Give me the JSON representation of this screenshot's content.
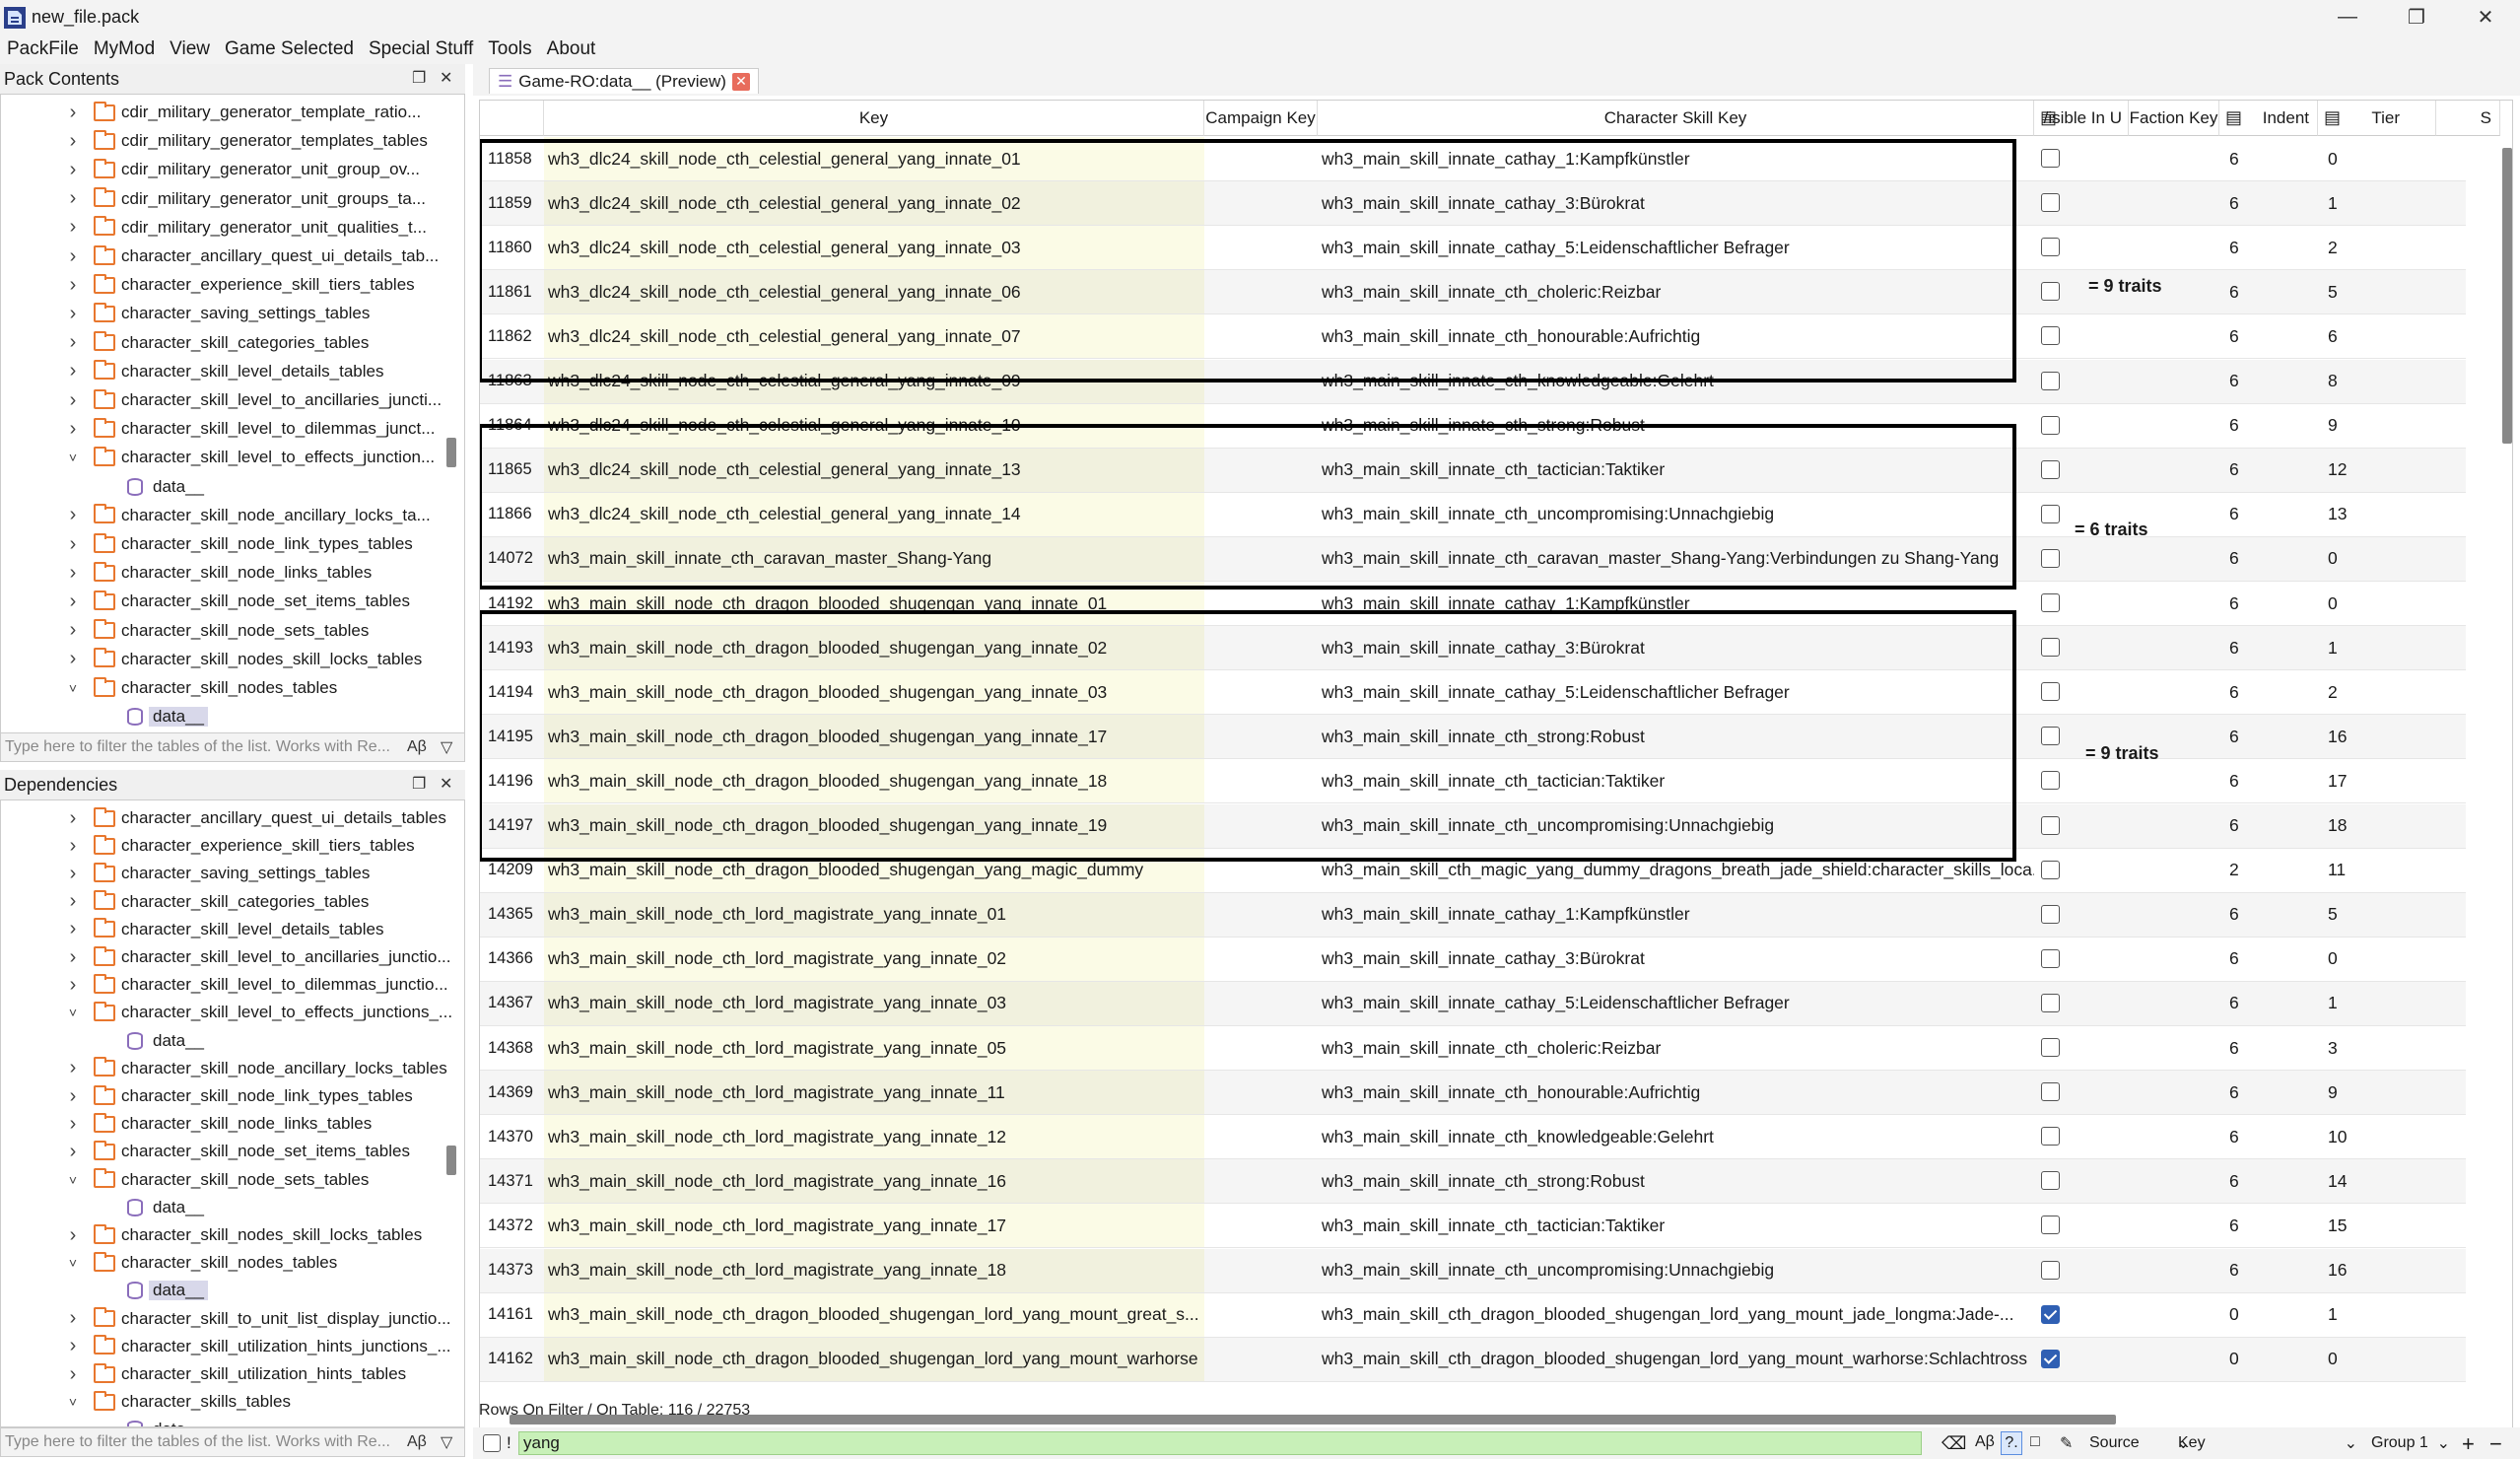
{
  "window": {
    "title": "new_file.pack"
  },
  "menu": [
    "PackFile",
    "MyMod",
    "View",
    "Game Selected",
    "Special Stuff",
    "Tools",
    "About"
  ],
  "pack_contents": {
    "title": "Pack Contents",
    "items": [
      {
        "label": "cdir_military_generator_template_ratio...",
        "type": "folder",
        "state": "collapsed"
      },
      {
        "label": "cdir_military_generator_templates_tables",
        "type": "folder",
        "state": "collapsed"
      },
      {
        "label": "cdir_military_generator_unit_group_ov...",
        "type": "folder",
        "state": "collapsed"
      },
      {
        "label": "cdir_military_generator_unit_groups_ta...",
        "type": "folder",
        "state": "collapsed"
      },
      {
        "label": "cdir_military_generator_unit_qualities_t...",
        "type": "folder",
        "state": "collapsed"
      },
      {
        "label": "character_ancillary_quest_ui_details_tab...",
        "type": "folder",
        "state": "collapsed"
      },
      {
        "label": "character_experience_skill_tiers_tables",
        "type": "folder",
        "state": "collapsed"
      },
      {
        "label": "character_saving_settings_tables",
        "type": "folder",
        "state": "collapsed"
      },
      {
        "label": "character_skill_categories_tables",
        "type": "folder",
        "state": "collapsed"
      },
      {
        "label": "character_skill_level_details_tables",
        "type": "folder",
        "state": "collapsed"
      },
      {
        "label": "character_skill_level_to_ancillaries_juncti...",
        "type": "folder",
        "state": "collapsed"
      },
      {
        "label": "character_skill_level_to_dilemmas_junct...",
        "type": "folder",
        "state": "collapsed"
      },
      {
        "label": "character_skill_level_to_effects_junction...",
        "type": "folder",
        "state": "expanded"
      },
      {
        "label": "data__",
        "type": "leaf"
      },
      {
        "label": "character_skill_node_ancillary_locks_ta...",
        "type": "folder",
        "state": "collapsed"
      },
      {
        "label": "character_skill_node_link_types_tables",
        "type": "folder",
        "state": "collapsed"
      },
      {
        "label": "character_skill_node_links_tables",
        "type": "folder",
        "state": "collapsed"
      },
      {
        "label": "character_skill_node_set_items_tables",
        "type": "folder",
        "state": "collapsed"
      },
      {
        "label": "character_skill_node_sets_tables",
        "type": "folder",
        "state": "collapsed"
      },
      {
        "label": "character_skill_nodes_skill_locks_tables",
        "type": "folder",
        "state": "collapsed"
      },
      {
        "label": "character_skill_nodes_tables",
        "type": "folder",
        "state": "expanded"
      },
      {
        "label": "data__",
        "type": "leaf",
        "selected": true
      }
    ],
    "filter_placeholder": "Type here to filter the tables of the list. Works with Re..."
  },
  "dependencies": {
    "title": "Dependencies",
    "items": [
      {
        "label": "character_ancillary_quest_ui_details_tables",
        "type": "folder",
        "state": "collapsed"
      },
      {
        "label": "character_experience_skill_tiers_tables",
        "type": "folder",
        "state": "collapsed"
      },
      {
        "label": "character_saving_settings_tables",
        "type": "folder",
        "state": "collapsed"
      },
      {
        "label": "character_skill_categories_tables",
        "type": "folder",
        "state": "collapsed"
      },
      {
        "label": "character_skill_level_details_tables",
        "type": "folder",
        "state": "collapsed"
      },
      {
        "label": "character_skill_level_to_ancillaries_junctio...",
        "type": "folder",
        "state": "collapsed"
      },
      {
        "label": "character_skill_level_to_dilemmas_junctio...",
        "type": "folder",
        "state": "collapsed"
      },
      {
        "label": "character_skill_level_to_effects_junctions_...",
        "type": "folder",
        "state": "expanded"
      },
      {
        "label": "data__",
        "type": "leaf"
      },
      {
        "label": "character_skill_node_ancillary_locks_tables",
        "type": "folder",
        "state": "collapsed"
      },
      {
        "label": "character_skill_node_link_types_tables",
        "type": "folder",
        "state": "collapsed"
      },
      {
        "label": "character_skill_node_links_tables",
        "type": "folder",
        "state": "collapsed"
      },
      {
        "label": "character_skill_node_set_items_tables",
        "type": "folder",
        "state": "collapsed"
      },
      {
        "label": "character_skill_node_sets_tables",
        "type": "folder",
        "state": "expanded"
      },
      {
        "label": "data__",
        "type": "leaf"
      },
      {
        "label": "character_skill_nodes_skill_locks_tables",
        "type": "folder",
        "state": "collapsed"
      },
      {
        "label": "character_skill_nodes_tables",
        "type": "folder",
        "state": "expanded"
      },
      {
        "label": "data__",
        "type": "leaf",
        "selected": true
      },
      {
        "label": "character_skill_to_unit_list_display_junctio...",
        "type": "folder",
        "state": "collapsed"
      },
      {
        "label": "character_skill_utilization_hints_junctions_...",
        "type": "folder",
        "state": "collapsed"
      },
      {
        "label": "character_skill_utilization_hints_tables",
        "type": "folder",
        "state": "collapsed"
      },
      {
        "label": "character_skills_tables",
        "type": "folder",
        "state": "expanded"
      },
      {
        "label": "data__",
        "type": "leaf"
      }
    ],
    "filter_placeholder": "Type here to filter the tables of the list. Works with Re..."
  },
  "tab": {
    "label": "Game-RO:data__ (Preview)"
  },
  "table": {
    "columns": [
      "Key",
      "Campaign Key",
      "Character Skill Key",
      "/isible In U",
      "Faction Key",
      "Indent",
      "Tier",
      "S"
    ],
    "rows": [
      [
        "11858",
        "wh3_dlc24_skill_node_cth_celestial_general_yang_innate_01",
        "wh3_main_skill_innate_cathay_1:Kampfkünstler",
        false,
        "6",
        "0"
      ],
      [
        "11859",
        "wh3_dlc24_skill_node_cth_celestial_general_yang_innate_02",
        "wh3_main_skill_innate_cathay_3:Bürokrat",
        false,
        "6",
        "1"
      ],
      [
        "11860",
        "wh3_dlc24_skill_node_cth_celestial_general_yang_innate_03",
        "wh3_main_skill_innate_cathay_5:Leidenschaftlicher Befrager",
        false,
        "6",
        "2"
      ],
      [
        "11861",
        "wh3_dlc24_skill_node_cth_celestial_general_yang_innate_06",
        "wh3_main_skill_innate_cth_choleric:Reizbar",
        false,
        "6",
        "5"
      ],
      [
        "11862",
        "wh3_dlc24_skill_node_cth_celestial_general_yang_innate_07",
        "wh3_main_skill_innate_cth_honourable:Aufrichtig",
        false,
        "6",
        "6"
      ],
      [
        "11863",
        "wh3_dlc24_skill_node_cth_celestial_general_yang_innate_09",
        "wh3_main_skill_innate_cth_knowledgeable:Gelehrt",
        false,
        "6",
        "8"
      ],
      [
        "11864",
        "wh3_dlc24_skill_node_cth_celestial_general_yang_innate_10",
        "wh3_main_skill_innate_cth_strong:Robust",
        false,
        "6",
        "9"
      ],
      [
        "11865",
        "wh3_dlc24_skill_node_cth_celestial_general_yang_innate_13",
        "wh3_main_skill_innate_cth_tactician:Taktiker",
        false,
        "6",
        "12"
      ],
      [
        "11866",
        "wh3_dlc24_skill_node_cth_celestial_general_yang_innate_14",
        "wh3_main_skill_innate_cth_uncompromising:Unnachgiebig",
        false,
        "6",
        "13"
      ],
      [
        "14072",
        "wh3_main_skill_innate_cth_caravan_master_Shang-Yang",
        "wh3_main_skill_innate_cth_caravan_master_Shang-Yang:Verbindungen zu Shang-Yang",
        false,
        "6",
        "0"
      ],
      [
        "14192",
        "wh3_main_skill_node_cth_dragon_blooded_shugengan_yang_innate_01",
        "wh3_main_skill_innate_cathay_1:Kampfkünstler",
        false,
        "6",
        "0"
      ],
      [
        "14193",
        "wh3_main_skill_node_cth_dragon_blooded_shugengan_yang_innate_02",
        "wh3_main_skill_innate_cathay_3:Bürokrat",
        false,
        "6",
        "1"
      ],
      [
        "14194",
        "wh3_main_skill_node_cth_dragon_blooded_shugengan_yang_innate_03",
        "wh3_main_skill_innate_cathay_5:Leidenschaftlicher Befrager",
        false,
        "6",
        "2"
      ],
      [
        "14195",
        "wh3_main_skill_node_cth_dragon_blooded_shugengan_yang_innate_17",
        "wh3_main_skill_innate_cth_strong:Robust",
        false,
        "6",
        "16"
      ],
      [
        "14196",
        "wh3_main_skill_node_cth_dragon_blooded_shugengan_yang_innate_18",
        "wh3_main_skill_innate_cth_tactician:Taktiker",
        false,
        "6",
        "17"
      ],
      [
        "14197",
        "wh3_main_skill_node_cth_dragon_blooded_shugengan_yang_innate_19",
        "wh3_main_skill_innate_cth_uncompromising:Unnachgiebig",
        false,
        "6",
        "18"
      ],
      [
        "14209",
        "wh3_main_skill_node_cth_dragon_blooded_shugengan_yang_magic_dummy",
        "wh3_main_skill_cth_magic_yang_dummy_dragons_breath_jade_shield:character_skills_loca...",
        false,
        "2",
        "11"
      ],
      [
        "14365",
        "wh3_main_skill_node_cth_lord_magistrate_yang_innate_01",
        "wh3_main_skill_innate_cathay_1:Kampfkünstler",
        false,
        "6",
        "5"
      ],
      [
        "14366",
        "wh3_main_skill_node_cth_lord_magistrate_yang_innate_02",
        "wh3_main_skill_innate_cathay_3:Bürokrat",
        false,
        "6",
        "0"
      ],
      [
        "14367",
        "wh3_main_skill_node_cth_lord_magistrate_yang_innate_03",
        "wh3_main_skill_innate_cathay_5:Leidenschaftlicher Befrager",
        false,
        "6",
        "1"
      ],
      [
        "14368",
        "wh3_main_skill_node_cth_lord_magistrate_yang_innate_05",
        "wh3_main_skill_innate_cth_choleric:Reizbar",
        false,
        "6",
        "3"
      ],
      [
        "14369",
        "wh3_main_skill_node_cth_lord_magistrate_yang_innate_11",
        "wh3_main_skill_innate_cth_honourable:Aufrichtig",
        false,
        "6",
        "9"
      ],
      [
        "14370",
        "wh3_main_skill_node_cth_lord_magistrate_yang_innate_12",
        "wh3_main_skill_innate_cth_knowledgeable:Gelehrt",
        false,
        "6",
        "10"
      ],
      [
        "14371",
        "wh3_main_skill_node_cth_lord_magistrate_yang_innate_16",
        "wh3_main_skill_innate_cth_strong:Robust",
        false,
        "6",
        "14"
      ],
      [
        "14372",
        "wh3_main_skill_node_cth_lord_magistrate_yang_innate_17",
        "wh3_main_skill_innate_cth_tactician:Taktiker",
        false,
        "6",
        "15"
      ],
      [
        "14373",
        "wh3_main_skill_node_cth_lord_magistrate_yang_innate_18",
        "wh3_main_skill_innate_cth_uncompromising:Unnachgiebig",
        false,
        "6",
        "16"
      ],
      [
        "14161",
        "wh3_main_skill_node_cth_dragon_blooded_shugengan_lord_yang_mount_great_s...",
        "wh3_main_skill_cth_dragon_blooded_shugengan_lord_yang_mount_jade_longma:Jade-...",
        true,
        "0",
        "1"
      ],
      [
        "14162",
        "wh3_main_skill_node_cth_dragon_blooded_shugengan_lord_yang_mount_warhorse",
        "wh3_main_skill_cth_dragon_blooded_shugengan_lord_yang_mount_warhorse:Schlachtross",
        true,
        "0",
        "0"
      ]
    ]
  },
  "annotations": [
    "= 9 traits",
    "= 6 traits",
    "= 9 traits"
  ],
  "status": {
    "text": "Rows On Filter / On Table: 116 / 22753"
  },
  "filter": {
    "not_label": "!",
    "value": "yang",
    "source_label": "Source",
    "column_label": "Key",
    "group_label": "Group 1"
  }
}
